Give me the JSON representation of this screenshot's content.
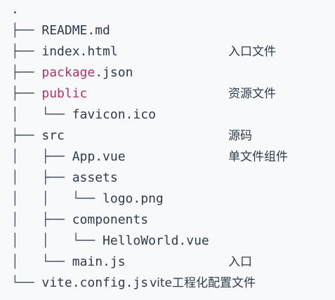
{
  "colors": {
    "background": "#f8f9fa",
    "text": "#2f3b4a",
    "accent": "#b2316a"
  },
  "tree": {
    "root": ".",
    "rows": [
      {
        "prefix": "├── ",
        "name": "README.md",
        "accent": false,
        "comment": ""
      },
      {
        "prefix": "├── ",
        "name": "index.html",
        "accent": false,
        "comment": "入口文件"
      },
      {
        "prefix": "├── ",
        "name": "package",
        "name_suffix": ".json",
        "accent": true,
        "comment": ""
      },
      {
        "prefix": "├── ",
        "name": "public",
        "accent": true,
        "comment": "资源文件"
      },
      {
        "prefix": "│   └── ",
        "name": "favicon.ico",
        "accent": false,
        "comment": ""
      },
      {
        "prefix": "├── ",
        "name": "src",
        "accent": false,
        "comment": "源码"
      },
      {
        "prefix": "│   ├── ",
        "name": "App.vue",
        "accent": false,
        "comment": "单文件组件"
      },
      {
        "prefix": "│   ├── ",
        "name": "assets",
        "accent": false,
        "comment": ""
      },
      {
        "prefix": "│   │   └── ",
        "name": "logo.png",
        "accent": false,
        "comment": ""
      },
      {
        "prefix": "│   ├── ",
        "name": "components",
        "accent": false,
        "comment": ""
      },
      {
        "prefix": "│   │   └── ",
        "name": "HelloWorld.vue",
        "accent": false,
        "comment": ""
      },
      {
        "prefix": "│   └── ",
        "name": "main.js",
        "accent": false,
        "comment": "入口"
      },
      {
        "prefix": "└── ",
        "name": "vite.config.js",
        "accent": false,
        "inline_comment": "vite工程化配置文件"
      }
    ]
  }
}
